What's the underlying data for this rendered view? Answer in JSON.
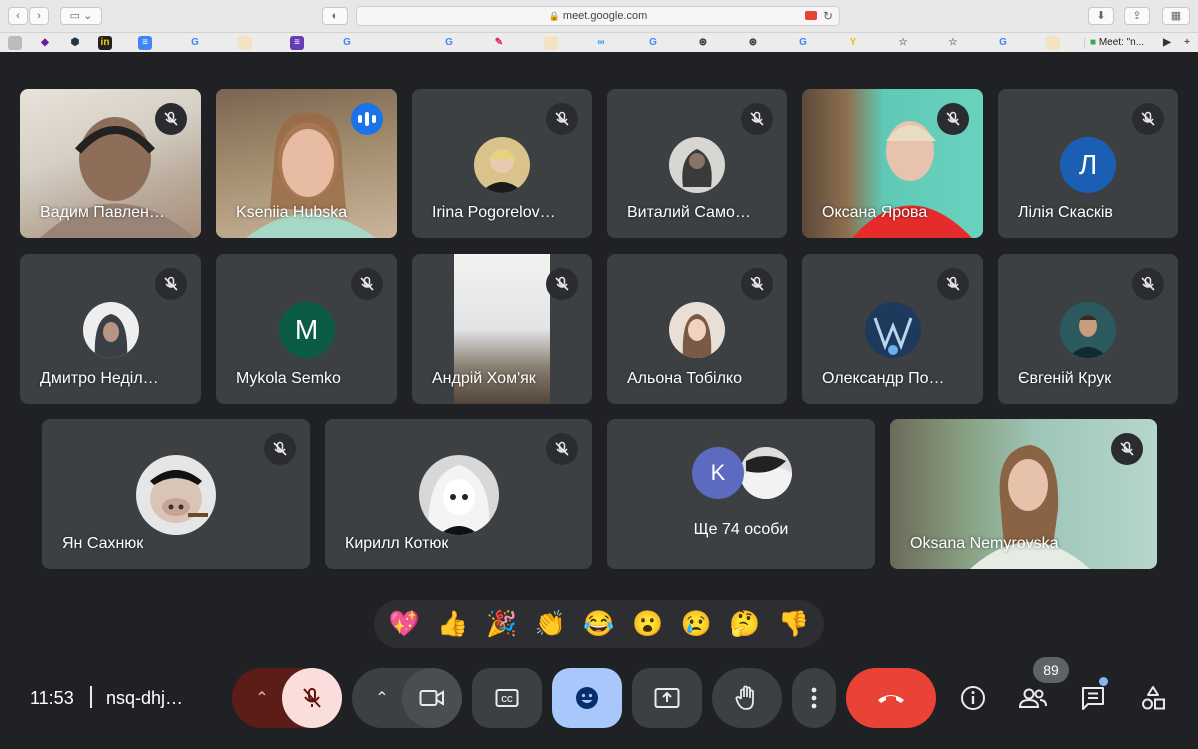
{
  "browser": {
    "url": "meet.google.com",
    "tab_title": "Meet: \"n..."
  },
  "tiles": [
    {
      "name": "Вадим Павлен…",
      "muted": true,
      "type": "video"
    },
    {
      "name": "Kseniia Hubska",
      "muted": false,
      "type": "video",
      "speaking": true
    },
    {
      "name": "Irina Pogorelov…",
      "muted": true,
      "type": "photo"
    },
    {
      "name": "Виталий Само…",
      "muted": true,
      "type": "photo"
    },
    {
      "name": "Оксана Ярова",
      "muted": true,
      "type": "video"
    },
    {
      "name": "Лілія Скаскiв",
      "muted": true,
      "type": "letter",
      "letter": "Л",
      "color": "#1a5fb4"
    },
    {
      "name": "Дмитро Неділ…",
      "muted": true,
      "type": "photo"
    },
    {
      "name": "Mykola Semko",
      "muted": true,
      "type": "letter",
      "letter": "M",
      "color": "#0b5c46"
    },
    {
      "name": "Андрій Хом'як",
      "muted": true,
      "type": "video"
    },
    {
      "name": "Альона Тобілко",
      "muted": true,
      "type": "photo"
    },
    {
      "name": "Олександр По…",
      "muted": true,
      "type": "photo"
    },
    {
      "name": "Євгеній Крук",
      "muted": true,
      "type": "photo"
    },
    {
      "name": "Ян Сахнюк",
      "muted": true,
      "type": "photo"
    },
    {
      "name": "Кирилл Котюк",
      "muted": true,
      "type": "photo"
    },
    {
      "name": "Ще 74 особи",
      "muted": false,
      "type": "others",
      "letter": "K"
    },
    {
      "name": "Oksana Nemyrovska",
      "muted": true,
      "type": "video"
    }
  ],
  "reactions": [
    "💖",
    "👍",
    "🎉",
    "👏",
    "😂",
    "😮",
    "😢",
    "🤔",
    "👎"
  ],
  "bottom": {
    "time": "11:53",
    "meeting_code": "nsq-dhj…",
    "participants_count": "89"
  },
  "colors": {
    "background": "#202124",
    "tile": "#3c4043",
    "speaking": "#1a73e8",
    "end_call": "#ea4335",
    "mic_off": "#f9dedc",
    "reactions_active": "#a8c7fa"
  }
}
